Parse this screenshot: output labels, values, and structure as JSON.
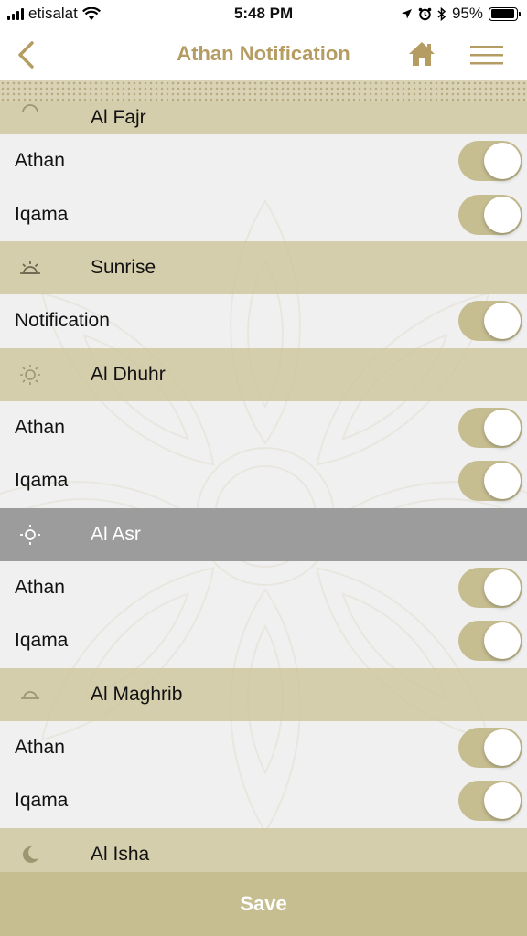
{
  "status_bar": {
    "carrier": "etisalat",
    "time": "5:48 PM",
    "battery_percent": "95%",
    "battery_level": 0.95
  },
  "header": {
    "title": "Athan Notification",
    "back_icon": "chevron-left-icon",
    "home_icon": "home-icon",
    "menu_icon": "hamburger-menu-icon"
  },
  "sections": [
    {
      "title": "Al Fajr",
      "icon": "dawn-icon",
      "active": false,
      "rows": [
        {
          "label": "Athan",
          "on": true
        },
        {
          "label": "Iqama",
          "on": true
        }
      ]
    },
    {
      "title": "Sunrise",
      "icon": "sunrise-icon",
      "active": false,
      "rows": [
        {
          "label": "Notification",
          "on": true
        }
      ]
    },
    {
      "title": "Al Dhuhr",
      "icon": "sun-icon",
      "active": false,
      "rows": [
        {
          "label": "Athan",
          "on": true
        },
        {
          "label": "Iqama",
          "on": true
        }
      ]
    },
    {
      "title": "Al Asr",
      "icon": "sun-small-icon",
      "active": true,
      "rows": [
        {
          "label": "Athan",
          "on": true
        },
        {
          "label": "Iqama",
          "on": true
        }
      ]
    },
    {
      "title": "Al Maghrib",
      "icon": "sunset-icon",
      "active": false,
      "rows": [
        {
          "label": "Athan",
          "on": true
        },
        {
          "label": "Iqama",
          "on": true
        }
      ]
    },
    {
      "title": "Al Isha",
      "icon": "crescent-moon-icon",
      "active": false,
      "rows": []
    }
  ],
  "save_label": "Save",
  "colors": {
    "accent": "#b59c62",
    "section_bg": "#d2caa4",
    "active_section_bg": "#9c9c9c",
    "toggle_on": "#c6bd91",
    "save_bg": "#c6bd91"
  }
}
